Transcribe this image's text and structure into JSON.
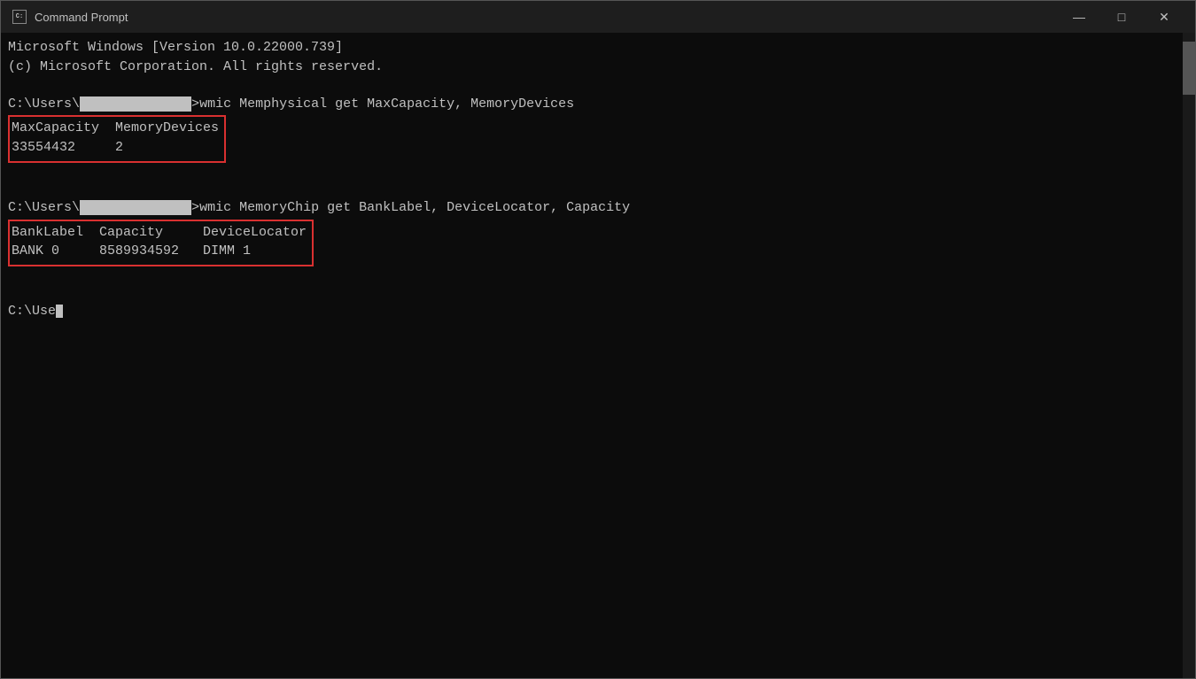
{
  "window": {
    "title": "Command Prompt",
    "icon": "cmd-icon"
  },
  "controls": {
    "minimize": "—",
    "maximize": "□",
    "close": "✕"
  },
  "terminal": {
    "line1": "Microsoft Windows [Version 10.0.22000.739]",
    "line2": "(c) Microsoft Corporation. All rights reserved.",
    "blank1": "",
    "cmd1_prompt": "C:\\Users\\",
    "cmd1_user": "              ",
    "cmd1_arrow": ">",
    "cmd1_command": "wmic Memphysical get MaxCapacity, MemoryDevices",
    "blank2": "",
    "table1_header": "MaxCapacity  MemoryDevices",
    "table1_row": "33554432     2",
    "blank3": "",
    "blank4": "",
    "cmd2_prompt": "C:\\Users\\",
    "cmd2_user": "              ",
    "cmd2_arrow": ">",
    "cmd2_command": "wmic MemoryChip get BankLabel, DeviceLocator, Capacity",
    "blank5": "",
    "table2_header": "BankLabel  Capacity     DeviceLocator",
    "table2_row": "BANK 0     8589934592   DIMM 1",
    "blank6": "",
    "blank7": "",
    "cmd3_prompt": "C:\\Use",
    "cursor_char": ""
  }
}
